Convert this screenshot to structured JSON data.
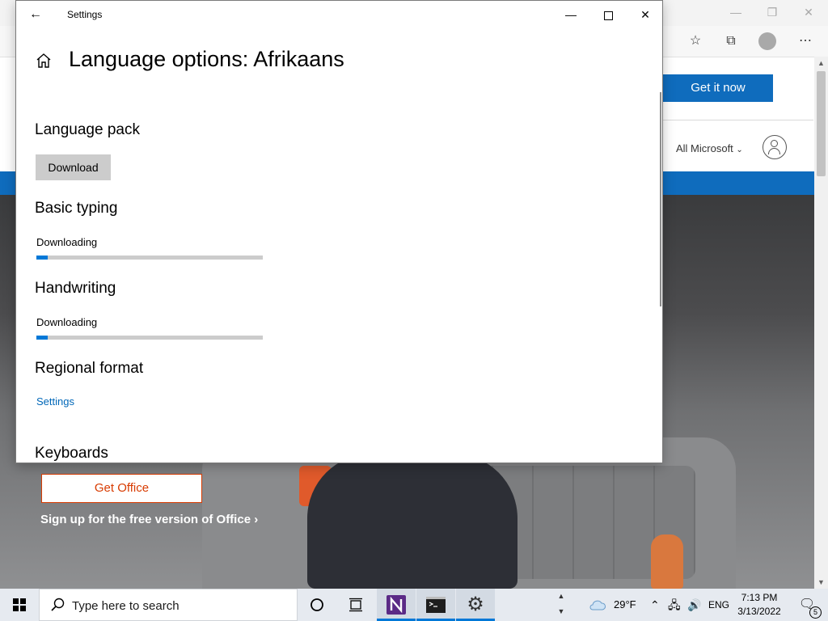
{
  "browser": {
    "get_it_now": "Get it now",
    "all_microsoft": "All Microsoft",
    "get_office": "Get Office",
    "signup": "Sign up for the free version of Office ›"
  },
  "settings": {
    "window_title": "Settings",
    "page_title": "Language options: Afrikaans",
    "language_pack": {
      "heading": "Language pack",
      "button": "Download"
    },
    "basic_typing": {
      "heading": "Basic typing",
      "status": "Downloading",
      "progress": 0.05
    },
    "handwriting": {
      "heading": "Handwriting",
      "status": "Downloading",
      "progress": 0.05
    },
    "regional_format": {
      "heading": "Regional format",
      "link": "Settings"
    },
    "keyboards": {
      "heading": "Keyboards"
    }
  },
  "taskbar": {
    "search_placeholder": "Type here to search",
    "weather": "29°F",
    "language": "ENG",
    "time": "7:13 PM",
    "date": "3/13/2022",
    "notification_count": "5"
  },
  "colors": {
    "accent": "#0078d7",
    "link": "#0067b8",
    "office_orange": "#d83b01",
    "edge_blue": "#0f6cbd"
  }
}
